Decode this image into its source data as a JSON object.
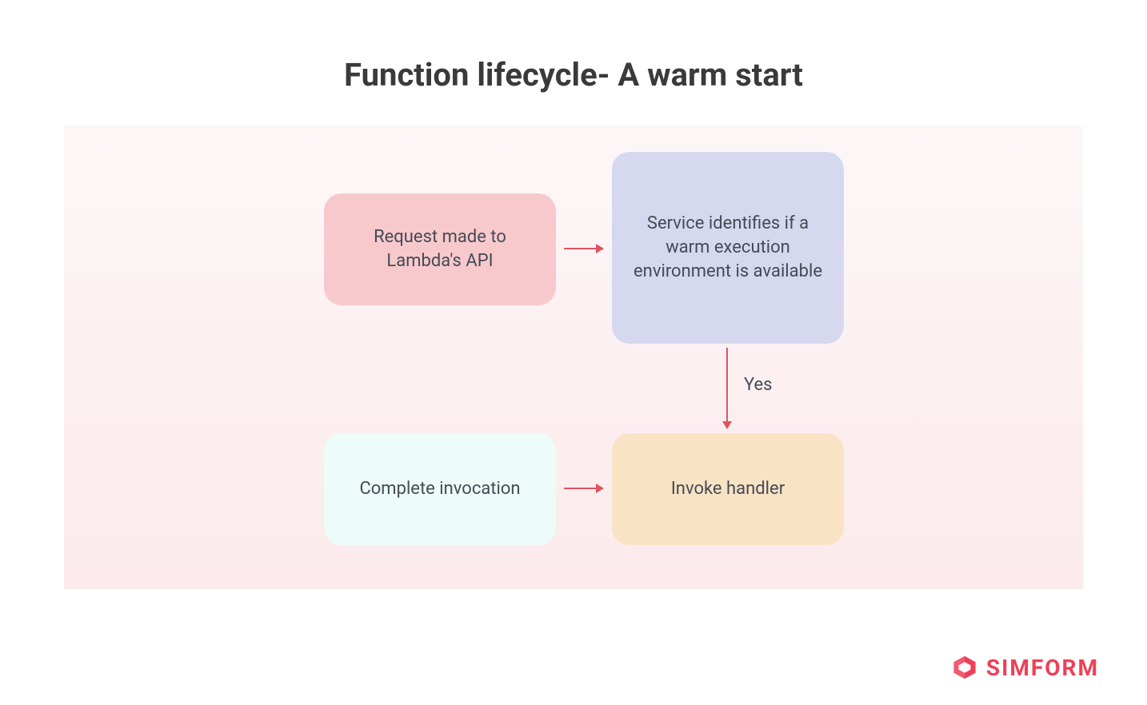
{
  "title": "Function lifecycle- A warm start",
  "nodes": {
    "request": "Request made to Lambda's API",
    "service": "Service identifies if a warm execution environment is available",
    "complete": "Complete invocation",
    "invoke": "Invoke handler"
  },
  "edges": {
    "yes_label": "Yes"
  },
  "brand": {
    "name": "SIMFORM"
  },
  "colors": {
    "node_request": "#f8c9cc",
    "node_service": "#d6d8f0",
    "node_complete": "#edfbf9",
    "node_invoke": "#f9e3c5",
    "arrow": "#e05261",
    "brand": "#ef3e57",
    "text": "#444b55"
  }
}
